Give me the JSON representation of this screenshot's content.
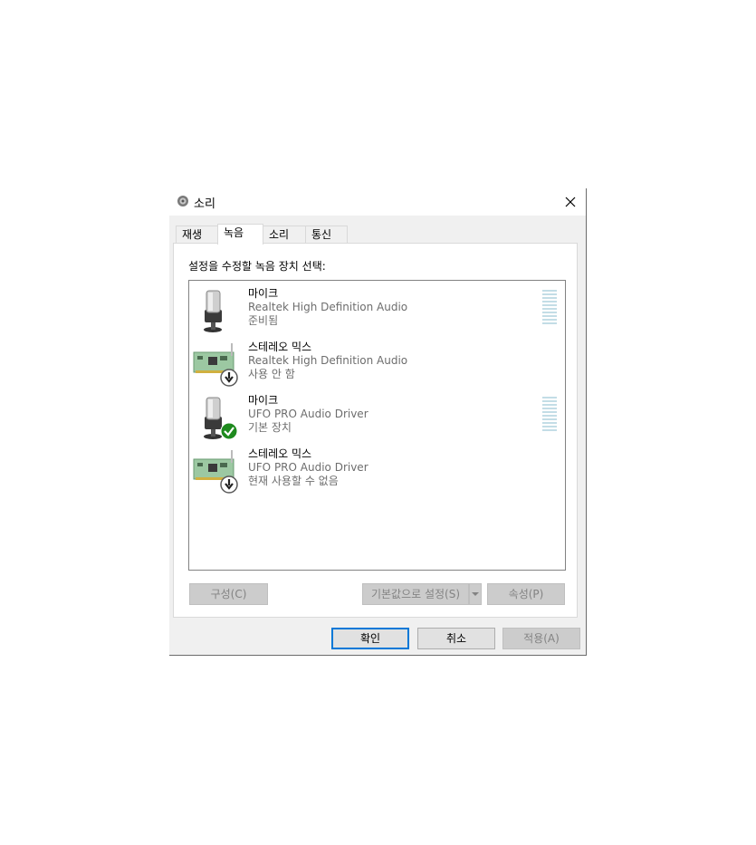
{
  "window": {
    "title": "소리",
    "close_icon": "close-icon",
    "app_icon": "speaker-icon"
  },
  "tabs": [
    {
      "label": "재생",
      "active": false
    },
    {
      "label": "녹음",
      "active": true
    },
    {
      "label": "소리",
      "active": false
    },
    {
      "label": "통신",
      "active": false
    }
  ],
  "instruction": "설정을 수정할 녹음 장치 선택:",
  "devices": [
    {
      "name": "마이크",
      "driver": "Realtek High Definition Audio",
      "status": "준비됨",
      "icon": "microphone-icon",
      "badge": "none",
      "level_meter": true
    },
    {
      "name": "스테레오 믹스",
      "driver": "Realtek High Definition Audio",
      "status": "사용 안 함",
      "icon": "sound-card-icon",
      "badge": "down-arrow-badge",
      "level_meter": false
    },
    {
      "name": "마이크",
      "driver": "UFO PRO Audio Driver",
      "status": "기본 장치",
      "icon": "microphone-icon",
      "badge": "default-check-badge",
      "level_meter": true
    },
    {
      "name": "스테레오 믹스",
      "driver": "UFO PRO Audio Driver",
      "status": "현재 사용할 수 없음",
      "icon": "sound-card-icon",
      "badge": "down-arrow-badge",
      "level_meter": false
    }
  ],
  "buttons": {
    "configure": "구성(C)",
    "set_default": "기본값으로 설정(S)",
    "properties": "속성(P)",
    "ok": "확인",
    "cancel": "취소",
    "apply": "적용(A)"
  },
  "colors": {
    "accent": "#0078d7",
    "check_green": "#1e8a1e",
    "disabled_button": "#cccccc"
  }
}
